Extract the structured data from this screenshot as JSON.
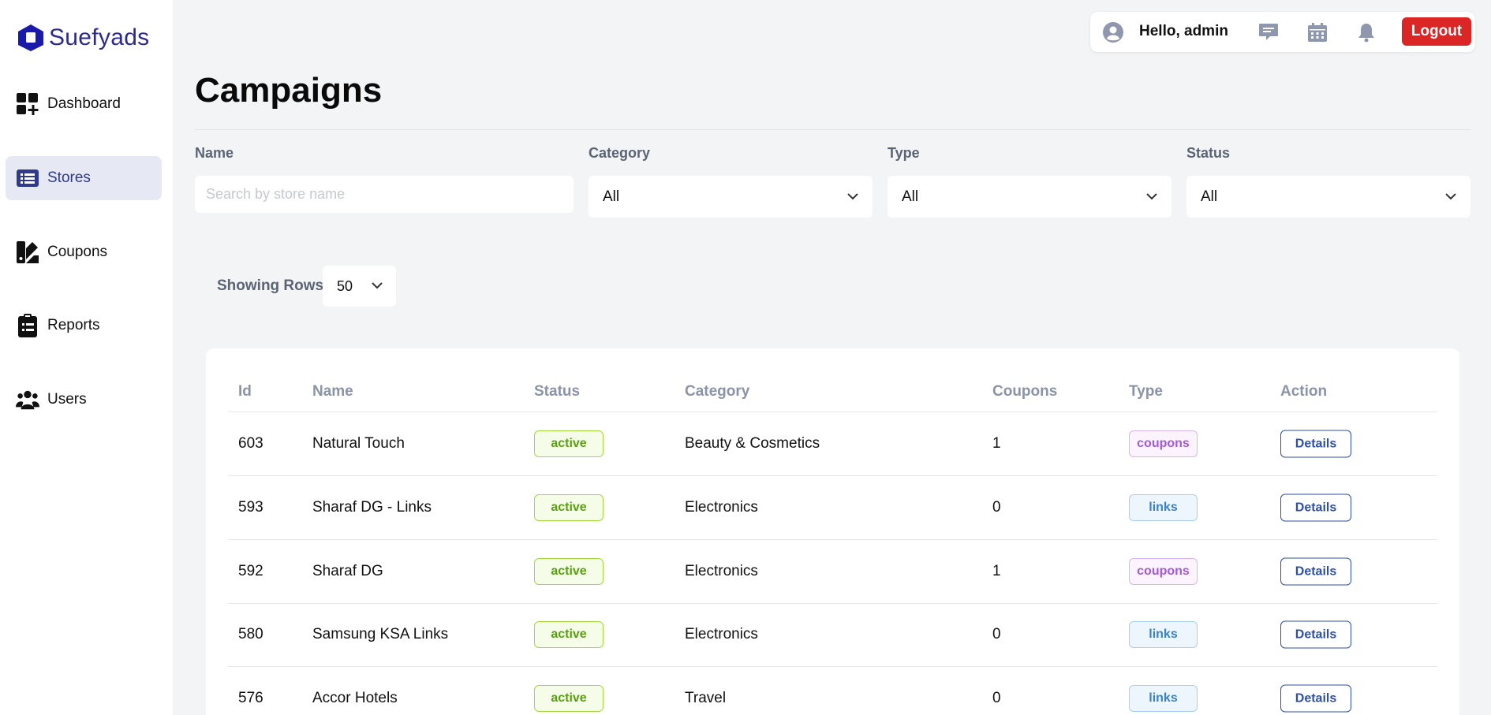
{
  "brand": {
    "name": "Suefyads",
    "accent": "#2b2a8a"
  },
  "sidebar": {
    "items": [
      {
        "label": "Dashboard",
        "icon": "dashboard-icon",
        "active": false
      },
      {
        "label": "Stores",
        "icon": "list-icon",
        "active": true
      },
      {
        "label": "Coupons",
        "icon": "coupons-icon",
        "active": false
      },
      {
        "label": "Reports",
        "icon": "clipboard-icon",
        "active": false
      },
      {
        "label": "Users",
        "icon": "users-icon",
        "active": false
      }
    ]
  },
  "topbar": {
    "greeting": "Hello, admin",
    "logout_label": "Logout",
    "logout_color": "#dc2626",
    "icons": [
      "avatar-icon",
      "message-icon",
      "calendar-icon",
      "bell-icon"
    ]
  },
  "page": {
    "title": "Campaigns"
  },
  "filters": {
    "name": {
      "label": "Name",
      "placeholder": "Search by store name",
      "value": ""
    },
    "category": {
      "label": "Category",
      "value": "All"
    },
    "type": {
      "label": "Type",
      "value": "All"
    },
    "status": {
      "label": "Status",
      "value": "All"
    }
  },
  "pagination": {
    "label": "Showing Rows",
    "value": "50"
  },
  "table": {
    "columns": [
      "Id",
      "Name",
      "Status",
      "Category",
      "Coupons",
      "Type",
      "Action"
    ],
    "rows": [
      {
        "id": "603",
        "name": "Natural Touch",
        "status": "active",
        "category": "Beauty & Cosmetics",
        "coupons": "1",
        "type": "coupons",
        "action": "Details"
      },
      {
        "id": "593",
        "name": "Sharaf DG - Links",
        "status": "active",
        "category": "Electronics",
        "coupons": "0",
        "type": "links",
        "action": "Details"
      },
      {
        "id": "592",
        "name": "Sharaf DG",
        "status": "active",
        "category": "Electronics",
        "coupons": "1",
        "type": "coupons",
        "action": "Details"
      },
      {
        "id": "580",
        "name": "Samsung KSA Links",
        "status": "active",
        "category": "Electronics",
        "coupons": "0",
        "type": "links",
        "action": "Details"
      },
      {
        "id": "576",
        "name": "Accor Hotels",
        "status": "active",
        "category": "Travel",
        "coupons": "0",
        "type": "links",
        "action": "Details"
      }
    ]
  }
}
